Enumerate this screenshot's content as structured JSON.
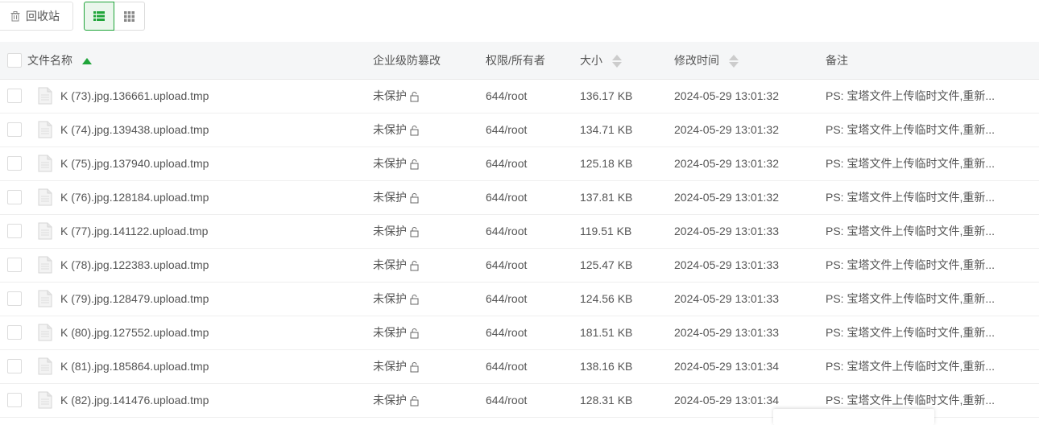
{
  "toolbar": {
    "recycle_label": "回收站"
  },
  "table": {
    "headers": {
      "name": "文件名称",
      "protection": "企业级防篡改",
      "permission": "权限/所有者",
      "size": "大小",
      "mtime": "修改时间",
      "note": "备注"
    },
    "rows": [
      {
        "name": "K (73).jpg.136661.upload.tmp",
        "protection": "未保护",
        "permission": "644/root",
        "size": "136.17 KB",
        "mtime": "2024-05-29 13:01:32",
        "note": "PS: 宝塔文件上传临时文件,重新..."
      },
      {
        "name": "K (74).jpg.139438.upload.tmp",
        "protection": "未保护",
        "permission": "644/root",
        "size": "134.71 KB",
        "mtime": "2024-05-29 13:01:32",
        "note": "PS: 宝塔文件上传临时文件,重新..."
      },
      {
        "name": "K (75).jpg.137940.upload.tmp",
        "protection": "未保护",
        "permission": "644/root",
        "size": "125.18 KB",
        "mtime": "2024-05-29 13:01:32",
        "note": "PS: 宝塔文件上传临时文件,重新..."
      },
      {
        "name": "K (76).jpg.128184.upload.tmp",
        "protection": "未保护",
        "permission": "644/root",
        "size": "137.81 KB",
        "mtime": "2024-05-29 13:01:32",
        "note": "PS: 宝塔文件上传临时文件,重新..."
      },
      {
        "name": "K (77).jpg.141122.upload.tmp",
        "protection": "未保护",
        "permission": "644/root",
        "size": "119.51 KB",
        "mtime": "2024-05-29 13:01:33",
        "note": "PS: 宝塔文件上传临时文件,重新..."
      },
      {
        "name": "K (78).jpg.122383.upload.tmp",
        "protection": "未保护",
        "permission": "644/root",
        "size": "125.47 KB",
        "mtime": "2024-05-29 13:01:33",
        "note": "PS: 宝塔文件上传临时文件,重新..."
      },
      {
        "name": "K (79).jpg.128479.upload.tmp",
        "protection": "未保护",
        "permission": "644/root",
        "size": "124.56 KB",
        "mtime": "2024-05-29 13:01:33",
        "note": "PS: 宝塔文件上传临时文件,重新..."
      },
      {
        "name": "K (80).jpg.127552.upload.tmp",
        "protection": "未保护",
        "permission": "644/root",
        "size": "181.51 KB",
        "mtime": "2024-05-29 13:01:33",
        "note": "PS: 宝塔文件上传临时文件,重新..."
      },
      {
        "name": "K (81).jpg.185864.upload.tmp",
        "protection": "未保护",
        "permission": "644/root",
        "size": "138.16 KB",
        "mtime": "2024-05-29 13:01:34",
        "note": "PS: 宝塔文件上传临时文件,重新..."
      },
      {
        "name": "K (82).jpg.141476.upload.tmp",
        "protection": "未保护",
        "permission": "644/root",
        "size": "128.31 KB",
        "mtime": "2024-05-29 13:01:34",
        "note": "PS: 宝塔文件上传临时文件,重新..."
      }
    ]
  },
  "colors": {
    "accent": "#20a53a",
    "header_bg": "#f5f6f7"
  },
  "icons": {
    "recycle": "trash-icon",
    "list_view": "list-view-icon",
    "grid_view": "grid-view-icon",
    "file": "file-icon",
    "lock": "lock-icon",
    "sort": "sort-icon"
  }
}
